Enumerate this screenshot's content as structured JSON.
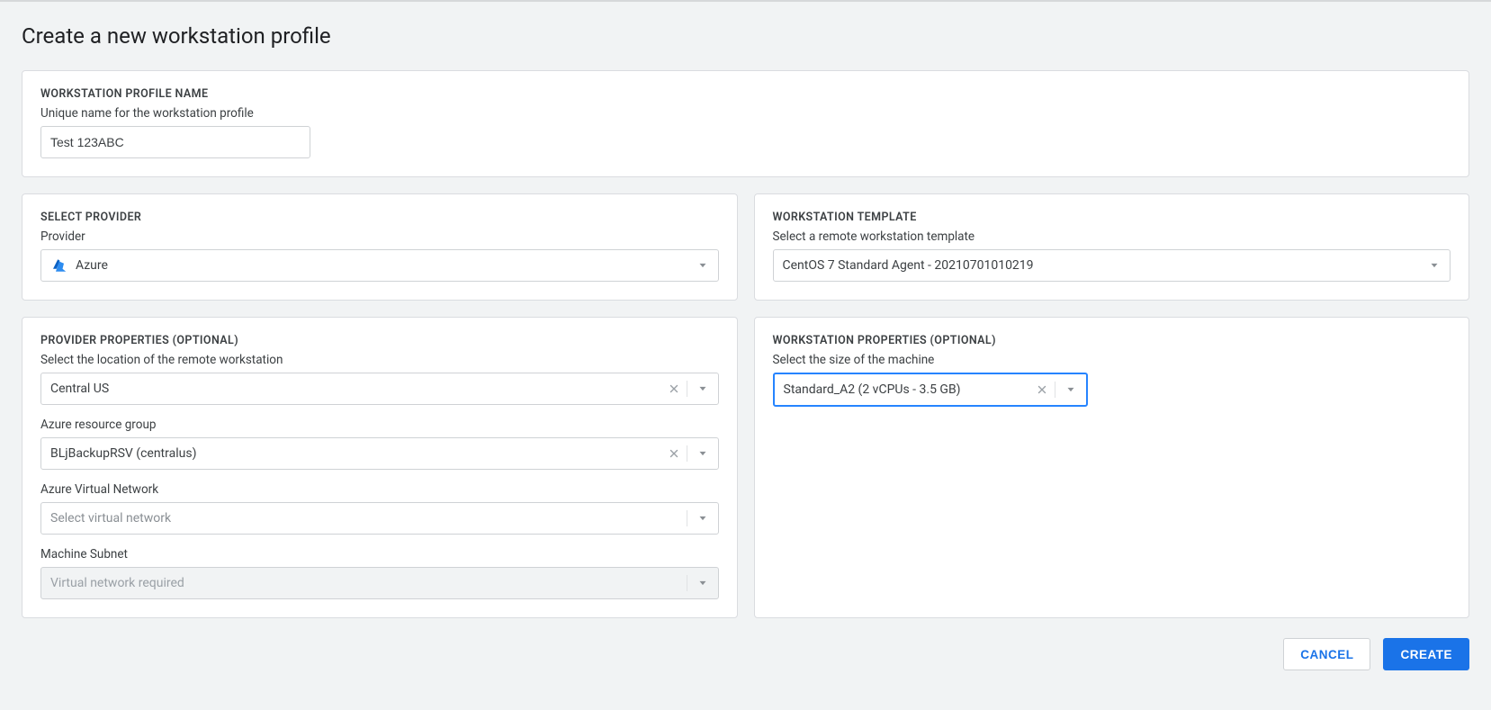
{
  "page": {
    "title": "Create a new workstation profile"
  },
  "name_section": {
    "label": "WORKSTATION PROFILE NAME",
    "hint": "Unique name for the workstation profile",
    "value": "Test 123ABC"
  },
  "provider_section": {
    "label": "SELECT PROVIDER",
    "field_label": "Provider",
    "value": "Azure"
  },
  "template_section": {
    "label": "WORKSTATION TEMPLATE",
    "hint": "Select a remote workstation template",
    "value": "CentOS 7 Standard Agent - 20210701010219"
  },
  "provider_props": {
    "label": "PROVIDER PROPERTIES (optional)",
    "location": {
      "label": "Select the location of the remote workstation",
      "value": "Central US"
    },
    "resource_group": {
      "label": "Azure resource group",
      "value": "BLjBackupRSV (centralus)"
    },
    "vnet": {
      "label": "Azure Virtual Network",
      "placeholder": "Select virtual network"
    },
    "subnet": {
      "label": "Machine Subnet",
      "placeholder": "Virtual network required"
    }
  },
  "workstation_props": {
    "label": "WORKSTATION PROPERTIES (optional)",
    "size": {
      "label": "Select the size of the machine",
      "value": "Standard_A2 (2 vCPUs - 3.5 GB)"
    }
  },
  "footer": {
    "cancel": "CANCEL",
    "create": "CREATE"
  }
}
